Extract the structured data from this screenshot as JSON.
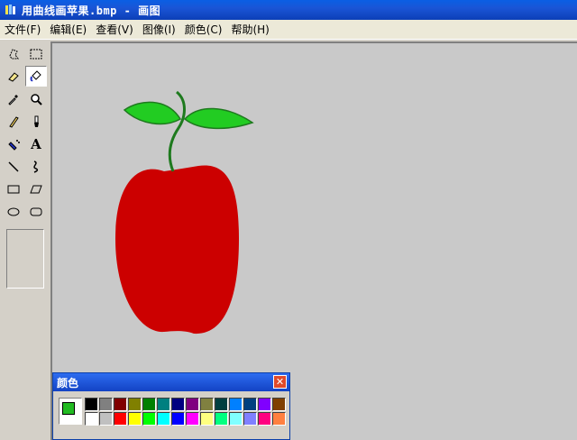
{
  "window": {
    "title": "用曲线画苹果.bmp - 画图"
  },
  "menu": [
    {
      "label": "文件(F)",
      "name": "menu-file"
    },
    {
      "label": "编辑(E)",
      "name": "menu-edit"
    },
    {
      "label": "查看(V)",
      "name": "menu-view"
    },
    {
      "label": "图像(I)",
      "name": "menu-image"
    },
    {
      "label": "颜色(C)",
      "name": "menu-colors"
    },
    {
      "label": "帮助(H)",
      "name": "menu-help"
    }
  ],
  "tools": [
    {
      "name": "free-form-select-tool",
      "icon": "free-form-select-icon"
    },
    {
      "name": "select-tool",
      "icon": "rect-select-icon"
    },
    {
      "name": "eraser-tool",
      "icon": "eraser-icon"
    },
    {
      "name": "fill-tool",
      "icon": "fill-bucket-icon",
      "selected": true
    },
    {
      "name": "pick-color-tool",
      "icon": "eyedropper-icon"
    },
    {
      "name": "magnifier-tool",
      "icon": "magnifier-icon"
    },
    {
      "name": "pencil-tool",
      "icon": "pencil-icon"
    },
    {
      "name": "brush-tool",
      "icon": "brush-icon"
    },
    {
      "name": "airbrush-tool",
      "icon": "airbrush-icon"
    },
    {
      "name": "text-tool",
      "icon": "text-icon",
      "glyph": "A"
    },
    {
      "name": "line-tool",
      "icon": "line-icon"
    },
    {
      "name": "curve-tool",
      "icon": "curve-icon"
    },
    {
      "name": "rectangle-tool",
      "icon": "rectangle-icon"
    },
    {
      "name": "polygon-tool",
      "icon": "polygon-icon"
    },
    {
      "name": "ellipse-tool",
      "icon": "ellipse-icon"
    },
    {
      "name": "rounded-rectangle-tool",
      "icon": "rounded-rectangle-icon"
    }
  ],
  "canvas": {
    "background": "#c9c9c9",
    "apple_color": "#cc0000",
    "leaf_color": "#22cc22",
    "stem_color": "#1e7a1e"
  },
  "color_box": {
    "title": "颜色",
    "close_glyph": "✕",
    "foreground": "#22bb22",
    "palette_top": [
      "#000000",
      "#808080",
      "#800000",
      "#808000",
      "#008000",
      "#008080",
      "#000080",
      "#800080",
      "#808040",
      "#004040",
      "#0080ff",
      "#004080",
      "#8000ff",
      "#804000"
    ],
    "palette_bottom": [
      "#ffffff",
      "#c0c0c0",
      "#ff0000",
      "#ffff00",
      "#00ff00",
      "#00ffff",
      "#0000ff",
      "#ff00ff",
      "#ffff80",
      "#00ff80",
      "#80ffff",
      "#8080ff",
      "#ff0080",
      "#ff8040"
    ]
  }
}
